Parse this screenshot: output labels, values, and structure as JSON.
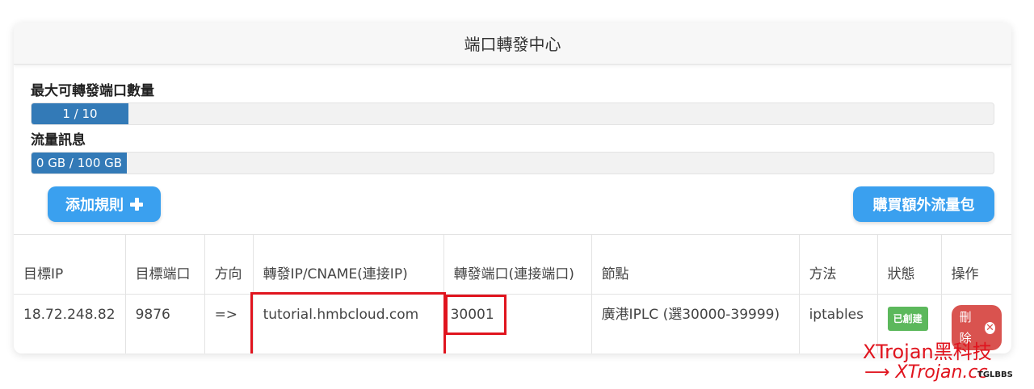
{
  "header": {
    "title": "端口轉發中心"
  },
  "port_quota": {
    "label": "最大可轉發端口數量",
    "text": "1 / 10",
    "fraction": 0.1
  },
  "traffic": {
    "label": "流量訊息",
    "text": "0 GB / 100 GB",
    "fraction": 0.1
  },
  "buttons": {
    "add_rule": "添加規則",
    "buy_traffic": "購買額外流量包"
  },
  "table": {
    "headers": [
      "目標IP",
      "目標端口",
      "方向",
      "轉發IP/CNAME(連接IP)",
      "轉發端口(連接端口)",
      "節點",
      "方法",
      "狀態",
      "操作"
    ],
    "rows": [
      {
        "target_ip": "18.72.248.82",
        "target_port": "9876",
        "direction": "=>",
        "forward_host": "tutorial.hmbcloud.com",
        "forward_port": "30001",
        "node": "廣港IPLC (選30000-39999)",
        "method": "iptables",
        "status": "已創建",
        "action": "刪除"
      }
    ]
  },
  "watermark": {
    "brand": "XTrojan黑科技",
    "site": "XTrojan.cc",
    "tag": "TGLBBS"
  },
  "colors": {
    "accent": "#3aa0ef",
    "progress": "#337ab7",
    "success": "#5cb85c",
    "danger": "#d9534f",
    "highlight": "#e0141e"
  }
}
